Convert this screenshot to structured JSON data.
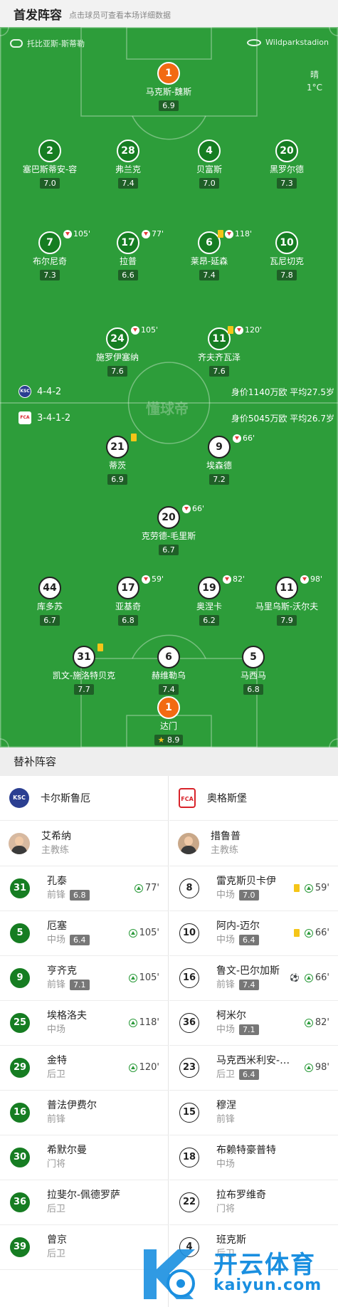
{
  "header": {
    "title": "首发阵容",
    "subtitle": "点击球员可查看本场详细数据"
  },
  "pitch": {
    "referee": "托比亚斯-斯蒂勒",
    "stadium": "Wildparkstadion",
    "weather": {
      "condition": "晴",
      "temperature": "1°C"
    },
    "watermark": "懂球帝",
    "home": {
      "formation": "4-4-2",
      "value": "身价1140万欧 平均27.5岁"
    },
    "away": {
      "formation": "3-4-1-2",
      "value": "身价5045万欧 平均26.7岁"
    },
    "home_players": [
      {
        "number": "1",
        "name": "马克斯-魏斯",
        "rating": "6.9"
      },
      {
        "number": "2",
        "name": "塞巴斯蒂安-容",
        "rating": "7.0"
      },
      {
        "number": "28",
        "name": "弗兰克",
        "rating": "7.4"
      },
      {
        "number": "4",
        "name": "贝富斯",
        "rating": "7.0"
      },
      {
        "number": "20",
        "name": "黑罗尔德",
        "rating": "7.3"
      },
      {
        "number": "7",
        "name": "布尔尼奇",
        "rating": "7.3",
        "sub_out": "105'"
      },
      {
        "number": "17",
        "name": "拉普",
        "rating": "6.6",
        "sub_out": "77'"
      },
      {
        "number": "6",
        "name": "莱昂-延森",
        "rating": "7.4",
        "sub_out": "118'"
      },
      {
        "number": "10",
        "name": "瓦尼切克",
        "rating": "7.8"
      },
      {
        "number": "24",
        "name": "施罗伊塞纳",
        "rating": "7.6",
        "sub_out": "105'"
      },
      {
        "number": "11",
        "name": "齐夫齐瓦泽",
        "rating": "7.6",
        "sub_out": "120'"
      }
    ],
    "away_players": [
      {
        "number": "21",
        "name": "蒂茨",
        "rating": "6.9"
      },
      {
        "number": "9",
        "name": "埃森德",
        "rating": "7.2",
        "sub_out": "66'"
      },
      {
        "number": "20",
        "name": "克劳德-毛里斯",
        "rating": "6.7",
        "sub_out": "66'"
      },
      {
        "number": "44",
        "name": "库多苏",
        "rating": "6.7"
      },
      {
        "number": "17",
        "name": "亚基奇",
        "rating": "6.8",
        "sub_out": "59'"
      },
      {
        "number": "19",
        "name": "奥涅卡",
        "rating": "6.2",
        "sub_out": "82'"
      },
      {
        "number": "11",
        "name": "马里乌斯-沃尔夫",
        "rating": "7.9",
        "sub_out": "98'"
      },
      {
        "number": "31",
        "name": "凯文-施洛特贝克",
        "rating": "7.7"
      },
      {
        "number": "6",
        "name": "赫维勒乌",
        "rating": "7.4"
      },
      {
        "number": "5",
        "name": "马西马",
        "rating": "6.8"
      },
      {
        "number": "1",
        "name": "达门",
        "rating": "8.9"
      }
    ]
  },
  "subs": {
    "title": "替补阵容",
    "home": {
      "team": "卡尔斯鲁厄",
      "logo_text": "KSC",
      "coach": {
        "name": "艾希纳",
        "role": "主教练"
      },
      "players": [
        {
          "number": "31",
          "name": "孔泰",
          "position": "前锋",
          "rating": "6.8",
          "sub_in": "77'"
        },
        {
          "number": "5",
          "name": "厄塞",
          "position": "中场",
          "rating": "6.4",
          "sub_in": "105'"
        },
        {
          "number": "9",
          "name": "亨齐克",
          "position": "前锋",
          "rating": "7.1",
          "sub_in": "105'"
        },
        {
          "number": "25",
          "name": "埃格洛夫",
          "position": "中场",
          "rating": "",
          "sub_in": "118'"
        },
        {
          "number": "29",
          "name": "金特",
          "position": "后卫",
          "rating": "",
          "sub_in": "120'"
        },
        {
          "number": "16",
          "name": "普法伊费尔",
          "position": "前锋",
          "rating": "",
          "sub_in": ""
        },
        {
          "number": "30",
          "name": "希默尔曼",
          "position": "门将",
          "rating": "",
          "sub_in": ""
        },
        {
          "number": "36",
          "name": "拉斐尔-佩德罗萨",
          "position": "后卫",
          "rating": "",
          "sub_in": ""
        },
        {
          "number": "39",
          "name": "曾京",
          "position": "后卫",
          "rating": "",
          "sub_in": ""
        }
      ]
    },
    "away": {
      "team": "奥格斯堡",
      "logo_text": "FCA",
      "coach": {
        "name": "措鲁普",
        "role": "主教练"
      },
      "players": [
        {
          "number": "8",
          "name": "雷克斯贝卡伊",
          "position": "中场",
          "rating": "7.0",
          "sub_in": "59'"
        },
        {
          "number": "10",
          "name": "阿内-迈尔",
          "position": "中场",
          "rating": "6.4",
          "sub_in": "66'"
        },
        {
          "number": "16",
          "name": "鲁文-巴尔加斯",
          "position": "前锋",
          "rating": "7.4",
          "sub_in": "66'"
        },
        {
          "number": "36",
          "name": "柯米尔",
          "position": "中场",
          "rating": "7.1",
          "sub_in": "82'"
        },
        {
          "number": "23",
          "name": "马克西米利安-鲍尔",
          "position": "后卫",
          "rating": "6.4",
          "sub_in": "98'"
        },
        {
          "number": "15",
          "name": "穆涅",
          "position": "前锋",
          "rating": "",
          "sub_in": ""
        },
        {
          "number": "18",
          "name": "布赖特豪普特",
          "position": "中场",
          "rating": "",
          "sub_in": ""
        },
        {
          "number": "22",
          "name": "拉布罗维奇",
          "position": "门将",
          "rating": "",
          "sub_in": ""
        },
        {
          "number": "4",
          "name": "班克斯",
          "position": "后卫",
          "rating": "",
          "sub_in": ""
        }
      ]
    }
  },
  "brand": {
    "name": "开云体育",
    "url": "kaiyun.com"
  },
  "colors": {
    "pitch": "#2d9d3a",
    "home": "#167d22",
    "gk": "#f26a12",
    "sub_in": "#2b9a3a",
    "sub_out": "#e53935",
    "yellow": "#f5c518"
  }
}
